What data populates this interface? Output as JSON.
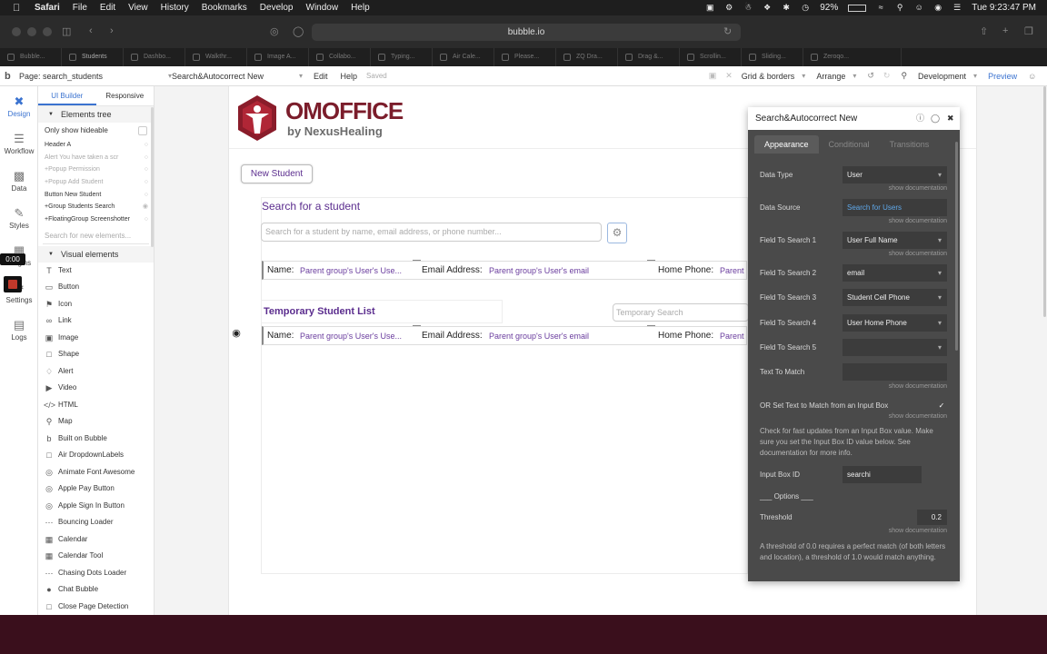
{
  "menubar": {
    "items": [
      "Safari",
      "File",
      "Edit",
      "View",
      "History",
      "Bookmarks",
      "Develop",
      "Window",
      "Help"
    ],
    "battery": "92%",
    "clock": "Tue 9:23:47 PM"
  },
  "safari": {
    "url": "bubble.io",
    "tabs": [
      "Bubble...",
      "Students",
      "Dashbo...",
      "Walkthr...",
      "Image A...",
      "Collabo...",
      "Typing...",
      "Air Cale...",
      "Please...",
      "ZQ Dra...",
      "Drag &...",
      "Scrollin...",
      "Sliding...",
      "Zeroqo..."
    ]
  },
  "bubble_bar": {
    "page_label": "Page: search_students",
    "element_select": "Search&Autocorrect New",
    "edit": "Edit",
    "help": "Help",
    "saved": "Saved",
    "grid": "Grid & borders",
    "arrange": "Arrange",
    "mode": "Development",
    "preview": "Preview"
  },
  "iconbar": {
    "items": [
      "Design",
      "Workflow",
      "Data",
      "Styles",
      "Plugins",
      "Settings",
      "Logs"
    ],
    "timer": "0:00"
  },
  "panel": {
    "tabs": [
      "UI Builder",
      "Responsive"
    ],
    "elements_tree": "Elements tree",
    "only_show": "Only show hideable",
    "tree": [
      "Header A",
      "Alert You have taken a scr",
      "+Popup Permission",
      "+Popup Add Student",
      "Button New Student",
      "+Group Students Search",
      "+FloatingGroup Screenshotter"
    ],
    "search_placeholder": "Search for new elements...",
    "visual_elements": "Visual elements",
    "visual": [
      "Text",
      "Button",
      "Icon",
      "Link",
      "Image",
      "Shape",
      "Alert",
      "Video",
      "HTML",
      "Map",
      "Built on Bubble",
      "Air DropdownLabels",
      "Animate Font Awesome",
      "Apple Pay Button",
      "Apple Sign In Button",
      "Bouncing Loader",
      "Calendar",
      "Calendar Tool",
      "Chasing Dots Loader",
      "Chat Bubble",
      "Close Page Detection"
    ]
  },
  "canvas": {
    "logo_main": "OmOffice",
    "logo_sub": "by NexusHealing",
    "new_student": "New Student",
    "search_title": "Search for a student",
    "search_placeholder": "Search for a student by name, email address, or phone number...",
    "row_name_label": "Name:",
    "row_name_value": "Parent group's User's Use...",
    "row_email_label": "Email Address:",
    "row_email_value": "Parent group's User's email",
    "row_phone_label": "Home Phone:",
    "row_phone_value": "Parent",
    "temp_title": "Temporary Student List",
    "temp_search": "Temporary Search"
  },
  "property_editor": {
    "title": "Search&Autocorrect New",
    "tabs": [
      "Appearance",
      "Conditional",
      "Transitions"
    ],
    "data_type_label": "Data Type",
    "data_type": "User",
    "data_source_label": "Data Source",
    "data_source": "Search for Users",
    "field1_label": "Field To Search 1",
    "field1": "User Full Name",
    "field2_label": "Field To Search 2",
    "field2": "email",
    "field3_label": "Field To Search 3",
    "field3": "Student Cell Phone",
    "field4_label": "Field To Search 4",
    "field4": "User Home Phone",
    "field5_label": "Field To Search 5",
    "text_match_label": "Text To Match",
    "or_set_label": "OR Set Text to Match from an Input Box",
    "help_text": "Check for fast updates from an Input Box value. Make sure you set the Input Box ID value below. See documentation for more info.",
    "input_box_label": "Input Box ID",
    "input_box": "searchi",
    "options": "___ Options ___",
    "threshold_label": "Threshold",
    "threshold": "0.2",
    "threshold_help": "A threshold of 0.0 requires a perfect match (of both letters and location), a threshold of 1.0 would match anything.",
    "show_doc": "show documentation"
  }
}
